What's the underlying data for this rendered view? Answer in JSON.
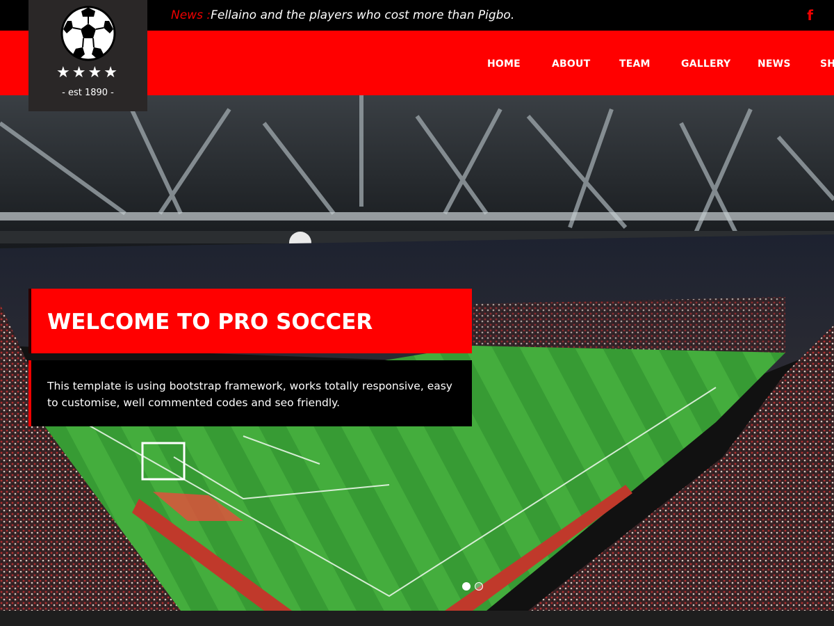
{
  "ticker": {
    "label": "News :",
    "text": "Fellaino and the players who cost more than Pigbo."
  },
  "social": {
    "facebook_icon": "f"
  },
  "logo": {
    "stars": "★★★★",
    "est": "- est 1890 -"
  },
  "nav": {
    "items": [
      "HOME",
      "ABOUT",
      "TEAM",
      "GALLERY",
      "NEWS",
      "SHOP"
    ]
  },
  "hero": {
    "title": "WELCOME TO PRO SOCCER",
    "description": "This template is using bootstrap framework, works totally responsive, easy to customise, well commented codes and seo friendly.",
    "slides": 2,
    "active_slide": 1
  },
  "colors": {
    "accent": "#ff0000",
    "dark": "#000000",
    "logo_bg": "#2a2727"
  }
}
